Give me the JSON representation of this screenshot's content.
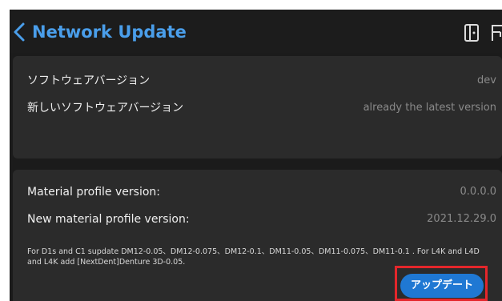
{
  "header": {
    "title": "Network Update",
    "back_icon": "chevron-left-icon",
    "right_icons": [
      "door-icon",
      "extra-icon"
    ],
    "accent_color": "#4a9eea"
  },
  "software_panel": {
    "rows": [
      {
        "label": "ソフトウェアバージョン",
        "value": "dev"
      },
      {
        "label": "新しいソフトウェアバージョン",
        "value": "already the latest version"
      }
    ]
  },
  "material_panel": {
    "rows": [
      {
        "label": "Material profile version:",
        "value": "0.0.0.0"
      },
      {
        "label": "New material profile version:",
        "value": "2021.12.29.0"
      }
    ],
    "note": "For D1s and C1  supdate DM12-0.05、DM12-0.075、DM12-0.1、DM11-0.05、DM11-0.075、DM11-0.1  . For L4K and L4D and L4K  add [NextDent]Denture 3D-0.05.",
    "update_button_label": "アップデート",
    "button_color": "#1f78d3",
    "highlight_color": "#e4262b"
  }
}
